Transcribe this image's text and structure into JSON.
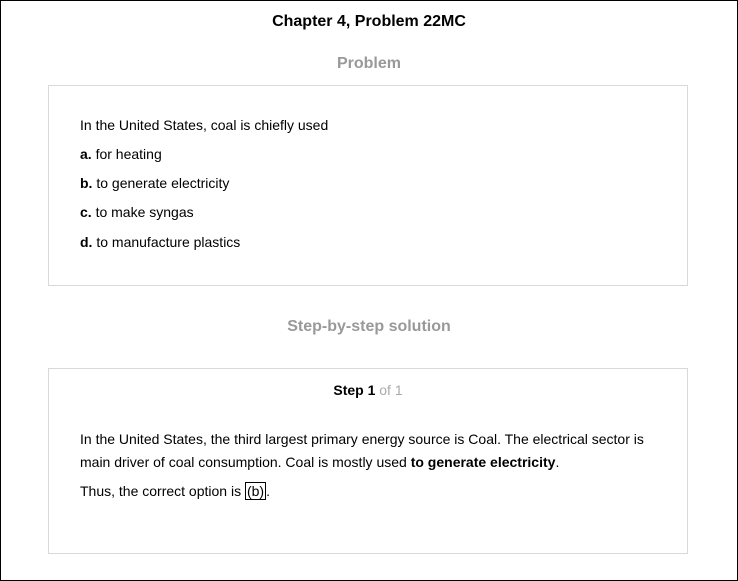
{
  "header": {
    "title": "Chapter 4, Problem 22MC"
  },
  "problem": {
    "heading": "Problem",
    "question": "In the United States, coal is chiefly used",
    "options": [
      {
        "letter": "a.",
        "text": "for heating"
      },
      {
        "letter": "b.",
        "text": "to generate electricity"
      },
      {
        "letter": "c.",
        "text": "to make syngas"
      },
      {
        "letter": "d.",
        "text": "to manufacture plastics"
      }
    ]
  },
  "solution": {
    "heading": "Step-by-step solution",
    "step_label": "Step 1",
    "step_total": "of 1",
    "paragraph_pre": "In the United States, the third largest primary energy source is Coal. The electrical sector is main driver of coal consumption. Coal is mostly used ",
    "paragraph_bold": "to generate electricity",
    "paragraph_post": ".",
    "conclusion_pre": "Thus, the correct option is ",
    "answer": "(b)",
    "conclusion_post": "."
  }
}
